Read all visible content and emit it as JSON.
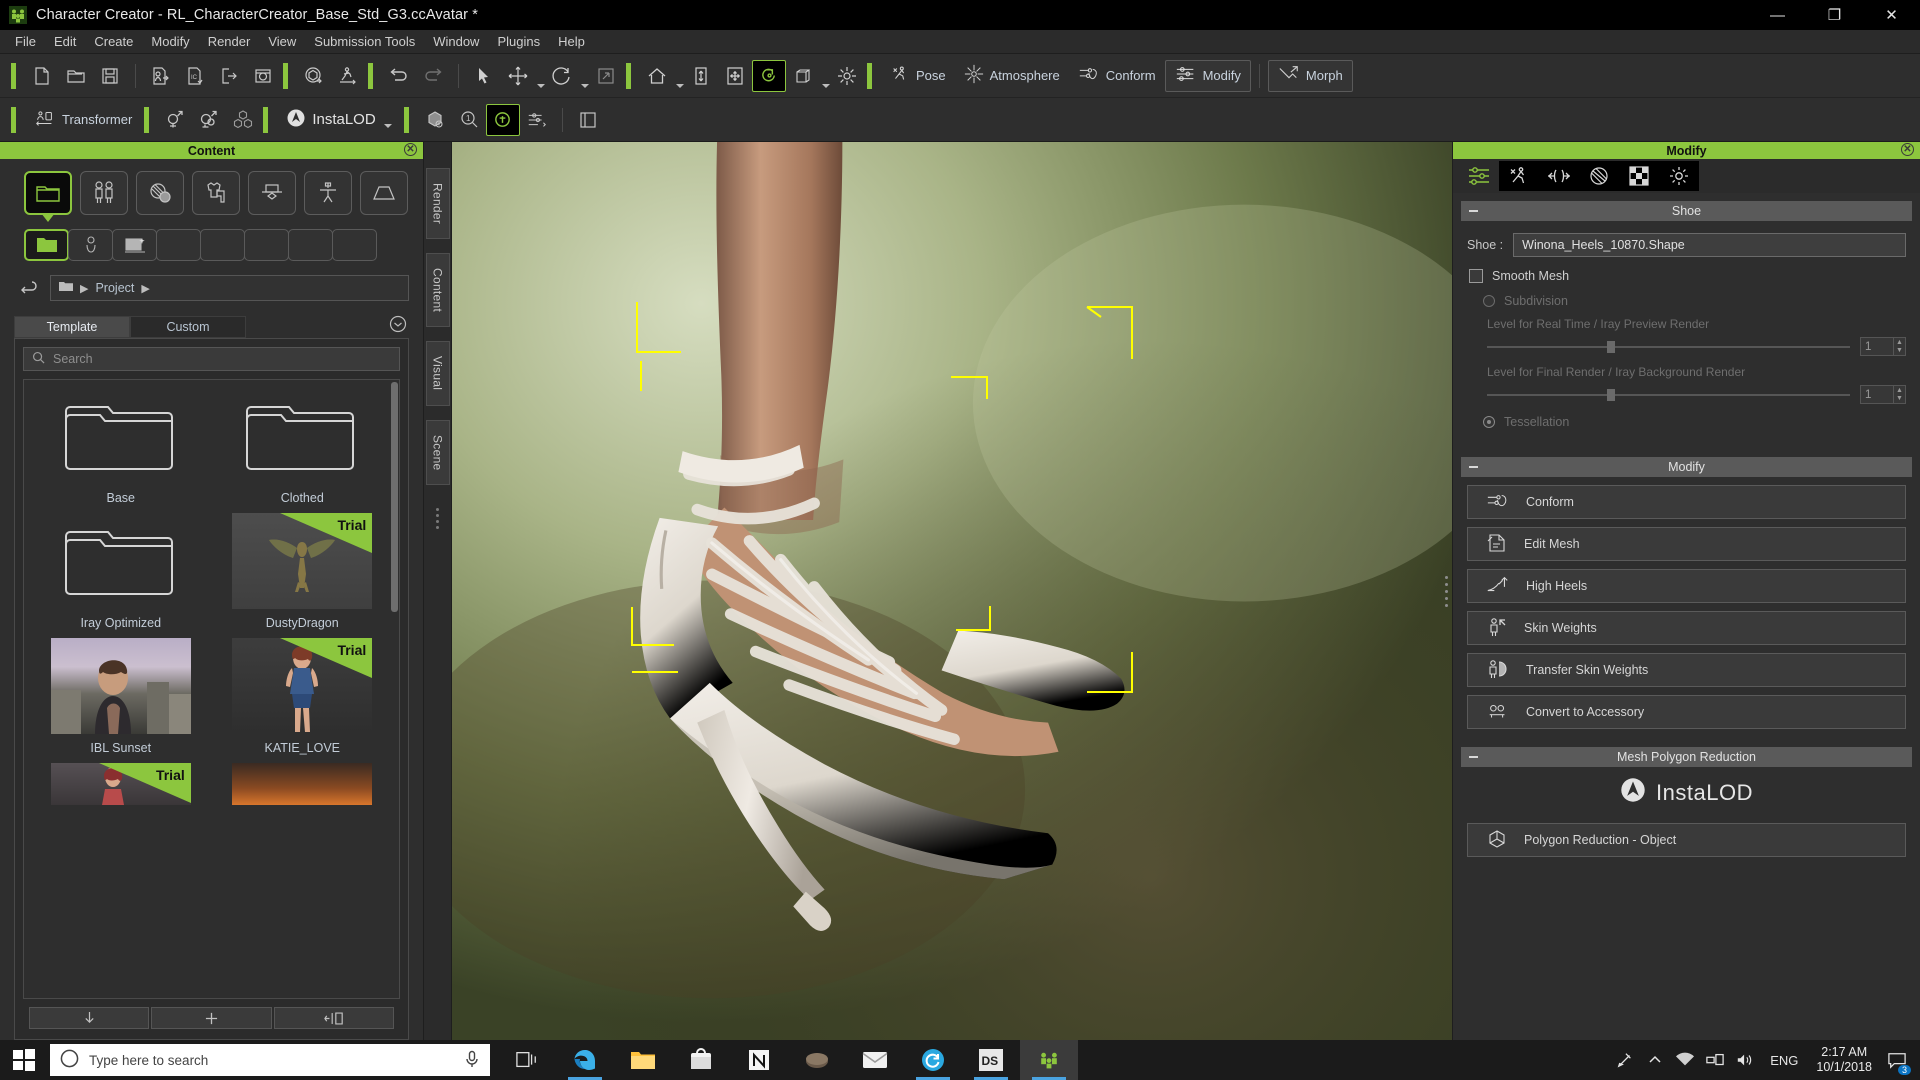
{
  "window": {
    "title": "Character Creator - RL_CharacterCreator_Base_Std_G3.ccAvatar *",
    "app_icon": "character-creator-icon",
    "minimize": "—",
    "maximize": "❐",
    "close": "✕"
  },
  "menu": [
    "File",
    "Edit",
    "Create",
    "Modify",
    "Render",
    "View",
    "Submission Tools",
    "Window",
    "Plugins",
    "Help"
  ],
  "toolbar_main": {
    "groups": [
      {
        "items": [
          {
            "name": "new-file-icon",
            "label": "New"
          },
          {
            "name": "open-file-icon",
            "label": "Open"
          },
          {
            "name": "save-file-icon",
            "label": "Save"
          }
        ]
      },
      {
        "items": [
          {
            "name": "import-character-icon",
            "label": "Import Character"
          },
          {
            "name": "import-prop-icon",
            "label": "Import Prop"
          },
          {
            "name": "export-icon",
            "label": "Export"
          },
          {
            "name": "save-image-icon",
            "label": "Save Image"
          }
        ]
      },
      {
        "items": [
          {
            "name": "transform-object-icon",
            "label": "Transform Object"
          },
          {
            "name": "animation-icon",
            "label": "Animation"
          }
        ]
      },
      {
        "items": [
          {
            "name": "undo-icon",
            "label": "Undo"
          },
          {
            "name": "redo-icon",
            "label": "Redo"
          }
        ]
      },
      {
        "items": [
          {
            "name": "select-tool-icon",
            "label": "Select"
          },
          {
            "name": "move-tool-icon",
            "label": "Move",
            "has_caret": true
          },
          {
            "name": "rotate-tool-icon",
            "label": "Rotate",
            "has_caret": true
          },
          {
            "name": "scale-tool-icon",
            "label": "Scale"
          }
        ]
      },
      {
        "items": [
          {
            "name": "home-view-icon",
            "label": "Home View",
            "has_caret": true
          },
          {
            "name": "fit-view-icon",
            "label": "Fit to View"
          },
          {
            "name": "pan-view-icon",
            "label": "Pan View"
          },
          {
            "name": "orbit-view-icon",
            "label": "Orbit View",
            "active": true
          },
          {
            "name": "camera-view-icon",
            "label": "Camera View",
            "has_caret": true
          },
          {
            "name": "light-icon",
            "label": "Light"
          }
        ]
      }
    ],
    "labeled": [
      {
        "name": "pose-button",
        "label": "Pose",
        "icon": "pose-icon"
      },
      {
        "name": "atmosphere-button",
        "label": "Atmosphere",
        "icon": "atmosphere-icon"
      },
      {
        "name": "conform-button",
        "label": "Conform",
        "icon": "conform-icon"
      },
      {
        "name": "modify-button",
        "label": "Modify",
        "icon": "modify-icon",
        "active": true
      },
      {
        "name": "morph-button",
        "label": "Morph",
        "icon": "morph-icon"
      }
    ]
  },
  "toolbar_second": {
    "transformer": {
      "label": "Transformer",
      "icon": "transformer-icon"
    },
    "icons": [
      {
        "name": "mirror-pose-icon",
        "label": "Mirror Pose"
      },
      {
        "name": "edit-pose-icon",
        "label": "Edit Pose"
      },
      {
        "name": "merge-objects-icon",
        "label": "Merge Objects"
      }
    ],
    "instalod": {
      "label": "InstaLOD",
      "icon": "instalod-icon",
      "has_caret": true
    },
    "right_icons": [
      {
        "name": "material-icon",
        "label": "Material"
      },
      {
        "name": "inspect-icon",
        "label": "Inspect"
      },
      {
        "name": "appearance-editor-icon",
        "label": "Appearance Editor",
        "active": true
      },
      {
        "name": "mesh-settings-icon",
        "label": "Mesh Settings"
      },
      {
        "name": "screen-capture-icon",
        "label": "Screen Capture"
      }
    ]
  },
  "content_panel": {
    "title": "Content",
    "close_icon": "close-icon",
    "categories": [
      {
        "name": "category-project",
        "icon": "folder-icon",
        "selected": true
      },
      {
        "name": "category-character",
        "icon": "two-people-icon"
      },
      {
        "name": "category-material",
        "icon": "material-sphere-icon"
      },
      {
        "name": "category-cloth",
        "icon": "shirt-pants-icon"
      },
      {
        "name": "category-accessory",
        "icon": "hat-bowtie-icon"
      },
      {
        "name": "category-pose",
        "icon": "pose-stand-icon"
      },
      {
        "name": "category-scene",
        "icon": "stage-icon"
      }
    ],
    "subcategories": [
      {
        "name": "subcategory-folder",
        "icon": "folder-filled-icon",
        "selected": true
      },
      {
        "name": "subcategory-avatar",
        "icon": "avatar-icon"
      },
      {
        "name": "subcategory-image",
        "icon": "image-star-icon"
      },
      {
        "name": "subcategory-4",
        "icon": "blank-icon"
      },
      {
        "name": "subcategory-5",
        "icon": "blank-icon"
      },
      {
        "name": "subcategory-6",
        "icon": "blank-icon"
      },
      {
        "name": "subcategory-7",
        "icon": "blank-icon"
      },
      {
        "name": "subcategory-8",
        "icon": "blank-icon"
      }
    ],
    "breadcrumb": {
      "back_icon": "back-arrow-icon",
      "folder_icon": "folder-small-icon",
      "path": "Project"
    },
    "tabs": [
      {
        "label": "Template",
        "active": true
      },
      {
        "label": "Custom",
        "active": false
      }
    ],
    "settings_icon": "settings-circle-icon",
    "search_placeholder": "Search",
    "search_value": "",
    "items": [
      {
        "label": "Base",
        "type": "folder",
        "trial": false
      },
      {
        "label": "Clothed",
        "type": "folder",
        "trial": false
      },
      {
        "label": "Iray Optimized",
        "type": "folder",
        "trial": false
      },
      {
        "label": "DustyDragon",
        "type": "thumbnail",
        "trial": true,
        "trial_label": "Trial",
        "thumb": "dragon"
      },
      {
        "label": "IBL Sunset",
        "type": "thumbnail",
        "trial": false,
        "thumb": "sunset"
      },
      {
        "label": "KATIE_LOVE",
        "type": "thumbnail",
        "trial": true,
        "trial_label": "Trial",
        "thumb": "katie"
      },
      {
        "label": "",
        "type": "thumbnail",
        "trial": true,
        "trial_label": "Trial",
        "thumb": "girl2"
      },
      {
        "label": "",
        "type": "thumbnail",
        "trial": false,
        "thumb": "fire"
      }
    ],
    "footer_buttons": [
      {
        "name": "download-button",
        "icon": "down-arrow-icon"
      },
      {
        "name": "add-button",
        "icon": "plus-icon"
      },
      {
        "name": "apply-button",
        "icon": "apply-icon"
      }
    ]
  },
  "dock_tabs": [
    "Render",
    "Content",
    "Visual",
    "Scene"
  ],
  "modify_panel": {
    "title": "Modify",
    "close_icon": "close-icon",
    "tabs": [
      {
        "name": "tab-attribute",
        "icon": "sliders-icon",
        "selected": true
      },
      {
        "name": "tab-pose",
        "icon": "pose-icon"
      },
      {
        "name": "tab-adjust",
        "icon": "adjust-icon"
      },
      {
        "name": "tab-material",
        "icon": "material-icon"
      },
      {
        "name": "tab-texture",
        "icon": "checker-icon"
      },
      {
        "name": "tab-settings",
        "icon": "gear-icon"
      }
    ],
    "shoe_section": {
      "header": "Shoe",
      "field_label": "Shoe :",
      "field_value": "Winona_Heels_10870.Shape",
      "smooth_mesh": {
        "label": "Smooth Mesh",
        "checked": false
      },
      "subdivision": {
        "label": "Subdivision",
        "selected": false
      },
      "realtime_label": "Level for Real Time / Iray Preview Render",
      "realtime_value": "1",
      "final_label": "Level for Final Render / Iray Background Render",
      "final_value": "1",
      "tessellation": {
        "label": "Tessellation",
        "selected": true
      }
    },
    "modify_section": {
      "header": "Modify",
      "buttons": [
        {
          "label": "Conform",
          "icon": "conform-icon"
        },
        {
          "label": "Edit Mesh",
          "icon": "edit-mesh-icon"
        },
        {
          "label": "High Heels",
          "icon": "high-heels-icon"
        },
        {
          "label": "Skin Weights",
          "icon": "skin-weights-icon"
        },
        {
          "label": "Transfer Skin Weights",
          "icon": "transfer-skin-weights-icon"
        },
        {
          "label": "Convert to Accessory",
          "icon": "convert-accessory-icon"
        }
      ]
    },
    "reduction_section": {
      "header": "Mesh Polygon Reduction",
      "brand": "InstaLOD",
      "brand_icon": "instalod-icon",
      "buttons": [
        {
          "label": "Polygon Reduction - Object",
          "icon": "polygon-reduction-icon"
        }
      ]
    }
  },
  "taskbar": {
    "start_icon": "windows-start-icon",
    "search_placeholder": "Type here to search",
    "search_icon": "search-circle-icon",
    "mic_icon": "microphone-icon",
    "apps": [
      {
        "name": "task-view-icon",
        "running": false
      },
      {
        "name": "edge-icon",
        "running": true
      },
      {
        "name": "file-explorer-icon",
        "running": false
      },
      {
        "name": "microsoft-store-icon",
        "running": false
      },
      {
        "name": "notion-icon",
        "running": false
      },
      {
        "name": "app-icon-6",
        "running": false
      },
      {
        "name": "mail-icon",
        "running": false
      },
      {
        "name": "sync-icon",
        "running": true
      },
      {
        "name": "daz-studio-icon",
        "running": true
      },
      {
        "name": "character-creator-icon",
        "running": true,
        "active": true
      }
    ],
    "tray": [
      {
        "name": "pen-icon"
      },
      {
        "name": "chevron-up-icon"
      },
      {
        "name": "wifi-icon"
      },
      {
        "name": "network-icon"
      },
      {
        "name": "volume-icon"
      }
    ],
    "language": "ENG",
    "time": "2:17 AM",
    "date": "10/1/2018",
    "notification_icon": "notification-icon",
    "notification_count": "3"
  },
  "colors": {
    "accent_green": "#8cc63e",
    "panel_bg": "#2e2e2e",
    "dark_bg": "#2b2b2b",
    "gizmo_yellow": "#ffff00"
  }
}
